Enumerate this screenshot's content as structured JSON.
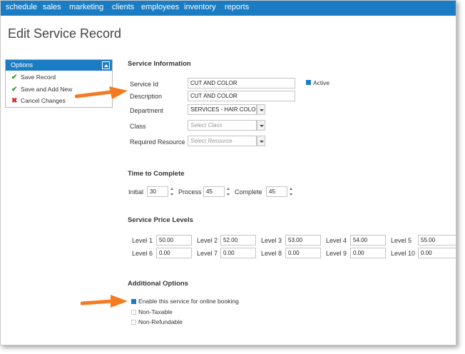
{
  "nav": [
    "schedule",
    "sales",
    "marketing",
    "clients",
    "employees",
    "inventory",
    "reports"
  ],
  "page_title": "Edit Service Record",
  "options": {
    "title": "Options",
    "items": [
      "Save Record",
      "Save and Add New",
      "Cancel Changes"
    ]
  },
  "service_info": {
    "title": "Service Information",
    "service_id_label": "Service Id",
    "service_id_value": "CUT AND COLOR",
    "active_label": "Active",
    "description_label": "Description",
    "description_value": "CUT AND COLOR",
    "department_label": "Department",
    "department_value": "SERVICES - HAIR COLOR",
    "class_label": "Class",
    "class_placeholder": "Select Class",
    "resource_label": "Required Resource",
    "resource_placeholder": "Select Resource"
  },
  "time": {
    "title": "Time to Complete",
    "initial_label": "Initial",
    "initial_value": "30",
    "process_label": "Process",
    "process_value": "45",
    "complete_label": "Complete",
    "complete_value": "45"
  },
  "price_levels": {
    "title": "Service Price Levels",
    "levels": [
      {
        "label": "Level 1",
        "value": "50.00"
      },
      {
        "label": "Level 2",
        "value": "52.00"
      },
      {
        "label": "Level 3",
        "value": "53.00"
      },
      {
        "label": "Level 4",
        "value": "54.00"
      },
      {
        "label": "Level 5",
        "value": "55.00"
      },
      {
        "label": "Level 6",
        "value": "0.00"
      },
      {
        "label": "Level 7",
        "value": "0.00"
      },
      {
        "label": "Level 8",
        "value": "0.00"
      },
      {
        "label": "Level 9",
        "value": "0.00"
      },
      {
        "label": "Level 10",
        "value": "0.00"
      }
    ]
  },
  "additional": {
    "title": "Additional Options",
    "online_booking": "Enable this service for online booking",
    "online_booking_checked": true,
    "non_taxable": "Non-Taxable",
    "non_taxable_checked": false,
    "non_refundable": "Non-Refundable",
    "non_refundable_checked": false
  },
  "colors": {
    "accent": "#1a7dc4",
    "annotation_arrow": "#f47b20"
  }
}
